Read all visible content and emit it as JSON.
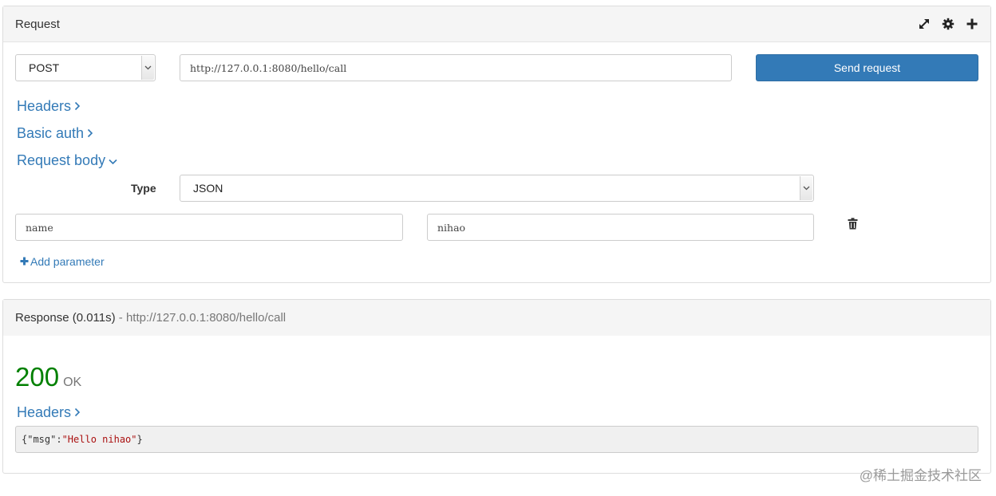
{
  "request": {
    "title": "Request",
    "method": "POST",
    "url": "http://127.0.0.1:8080/hello/call",
    "send_label": "Send request",
    "headers_label": "Headers",
    "basic_auth_label": "Basic auth",
    "body_label": "Request body",
    "type_label": "Type",
    "type_value": "JSON",
    "params": [
      {
        "key": "name",
        "value": "nihao"
      }
    ],
    "add_param_label": "Add parameter"
  },
  "response": {
    "title": "Response (0.011s)",
    "separator": " - ",
    "url": "http://127.0.0.1:8080/hello/call",
    "status_code": "200",
    "status_text": "OK",
    "headers_label": "Headers",
    "body_open": "{\"msg\":",
    "body_value": "\"Hello nihao\"",
    "body_close": "}"
  },
  "watermark": "@稀土掘金技术社区",
  "icons": [
    "expand-icon",
    "gear-icon",
    "plus-icon",
    "chevron-right-icon",
    "chevron-down-icon",
    "trash-icon",
    "caret-down-icon"
  ],
  "colors": {
    "link": "#337ab7",
    "primary": "#337ab7",
    "status_ok": "#008000"
  }
}
